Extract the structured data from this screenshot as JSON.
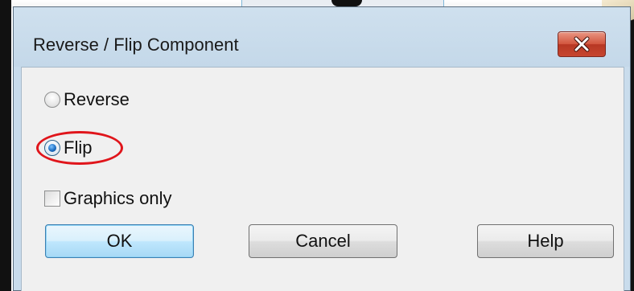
{
  "window": {
    "title": "Reverse / Flip Component"
  },
  "options": {
    "reverse": {
      "label": "Reverse",
      "checked": false
    },
    "flip": {
      "label": "Flip",
      "checked": true
    },
    "graphics_only": {
      "label": "Graphics only",
      "checked": false
    }
  },
  "buttons": {
    "ok": "OK",
    "cancel": "Cancel",
    "help": "Help"
  },
  "icons": {
    "close": "close-icon",
    "radio_checked": "radio-checked-icon",
    "radio_unchecked": "radio-unchecked-icon",
    "checkbox": "checkbox-icon"
  },
  "colors": {
    "title_bar": "#c4d8e9",
    "close_button": "#c6452f",
    "client_bg": "#f0f0f0",
    "highlight": "#e0151b",
    "default_button": "#bee6fd"
  }
}
